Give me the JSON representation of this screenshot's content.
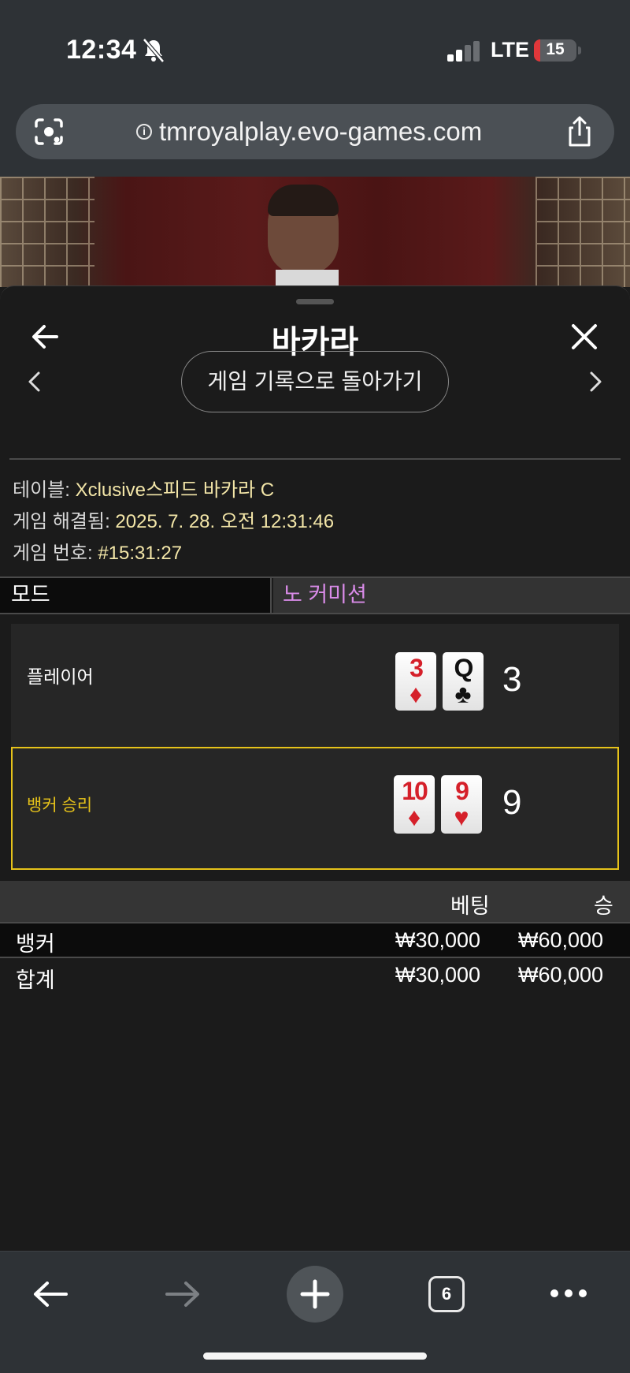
{
  "status_bar": {
    "time": "12:34",
    "network": "LTE",
    "battery": "15",
    "battery_level": 0.15,
    "battery_color": "#e0373a"
  },
  "browser": {
    "url": "tmroyalplay.evo-games.com",
    "tab_count": "6"
  },
  "sheet": {
    "title": "바카라",
    "history_button": "게임 기록으로 돌아가기",
    "info": {
      "table_label": "테이블:",
      "table_value": "Xclusive스피드 바카라 C",
      "resolved_label": "게임 해결됨:",
      "resolved_value": "2025. 7. 28. 오전 12:31:46",
      "number_label": "게임 번호:",
      "number_value": "#15:31:27"
    },
    "mode": {
      "label": "모드",
      "value": "노 커미션",
      "value_color": "#d98be8"
    },
    "player": {
      "label": "플레이어",
      "cards": [
        {
          "rank": "3",
          "suit": "♦",
          "color": "red"
        },
        {
          "rank": "Q",
          "suit": "♣",
          "color": "black"
        }
      ],
      "score": "3"
    },
    "banker": {
      "label": "뱅커 승리",
      "cards": [
        {
          "rank": "10",
          "suit": "♦",
          "color": "red"
        },
        {
          "rank": "9",
          "suit": "♥",
          "color": "red"
        }
      ],
      "score": "9",
      "highlight_color": "#e6c21a"
    },
    "bets_table": {
      "columns": [
        "",
        "베팅",
        "승"
      ],
      "rows": [
        {
          "name": "뱅커",
          "bet": "₩30,000",
          "win": "₩60,000"
        }
      ],
      "total": {
        "name": "합계",
        "bet": "₩30,000",
        "win": "₩60,000"
      }
    }
  },
  "icons": [
    "bell-slash-icon",
    "signal-icon",
    "camera-lens-icon",
    "info-icon",
    "share-icon",
    "back-arrow-icon",
    "close-icon",
    "chevron-left-icon",
    "chevron-right-icon",
    "nav-back-icon",
    "nav-forward-icon",
    "plus-icon",
    "tabs-icon",
    "more-icon"
  ]
}
